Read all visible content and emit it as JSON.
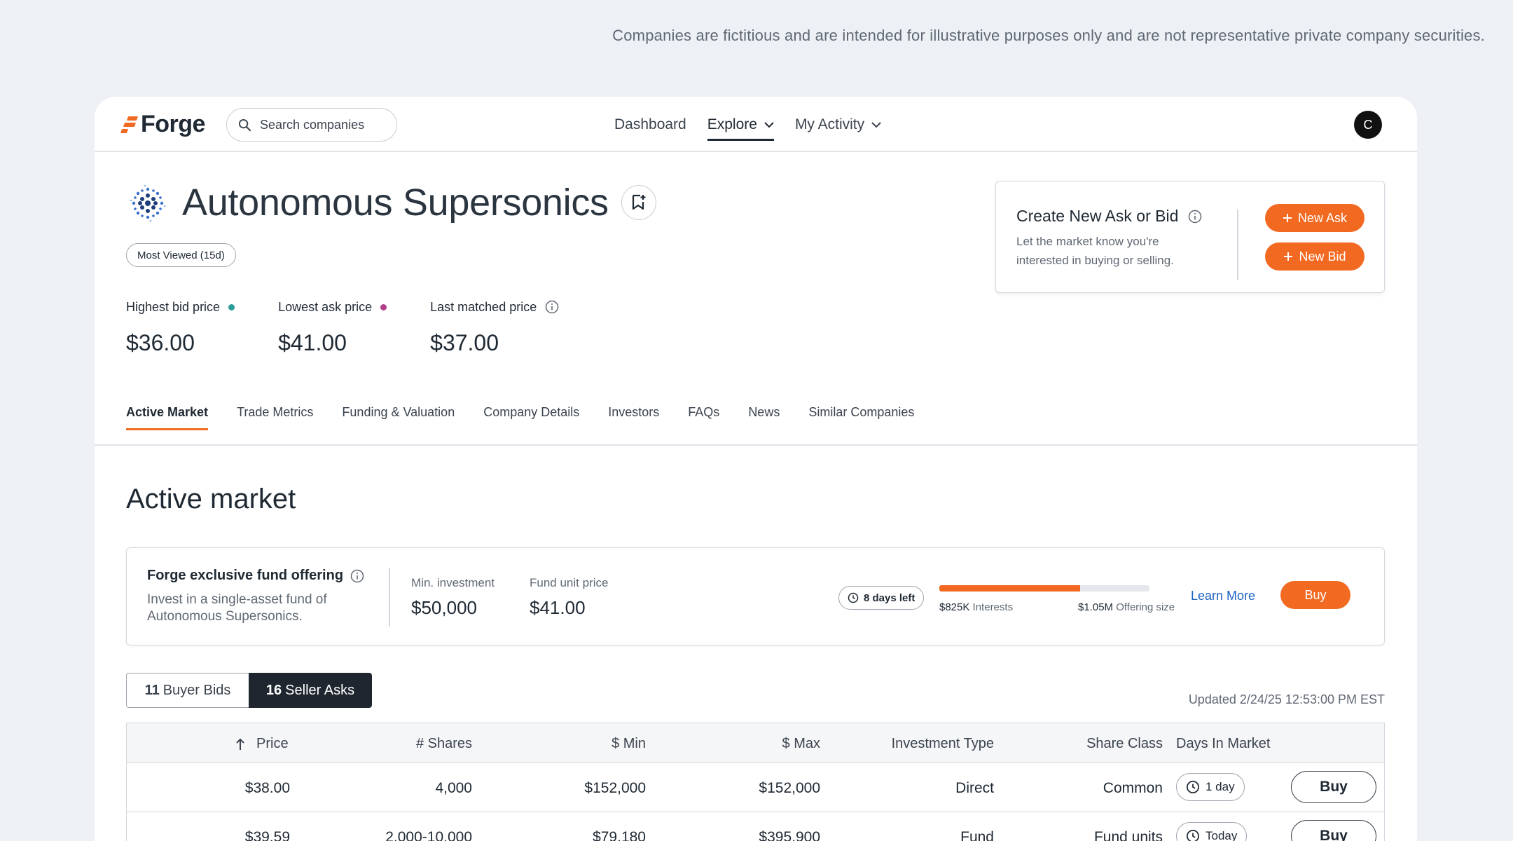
{
  "disclaimer": "Companies are fictitious and are intended for illustrative purposes only and are not representative private company securities.",
  "nav": {
    "brand": "Forge",
    "search_placeholder": "Search companies",
    "links": [
      "Dashboard",
      "Explore",
      "My Activity"
    ],
    "avatar_initial": "C"
  },
  "company": {
    "name": "Autonomous Supersonics",
    "badge": "Most Viewed (15d)"
  },
  "prices": [
    {
      "label": "Highest bid price",
      "value": "$36.00",
      "dot_color": "#2a9d9b"
    },
    {
      "label": "Lowest ask price",
      "value": "$41.00",
      "dot_color": "#b03f8b"
    },
    {
      "label": "Last matched price",
      "value": "$37.00"
    }
  ],
  "create": {
    "title": "Create New Ask or Bid",
    "desc": "Let the market know you're interested in buying or selling.",
    "new_ask": "New Ask",
    "new_bid": "New Bid"
  },
  "tabs": [
    "Active Market",
    "Trade Metrics",
    "Funding & Valuation",
    "Company Details",
    "Investors",
    "FAQs",
    "News",
    "Similar Companies"
  ],
  "section_title": "Active market",
  "fund": {
    "title": "Forge exclusive fund offering",
    "desc": "Invest in a single-asset fund of Autonomous Supersonics.",
    "min_label": "Min. investment",
    "min_value": "$50,000",
    "unit_label": "Fund unit price",
    "unit_value": "$41.00",
    "days_left": "8 days left",
    "progress": 0.67,
    "interests_value": "$825K",
    "interests_label": "Interests",
    "offering_value": "$1.05M",
    "offering_label": "Offering size",
    "learn_more": "Learn More",
    "buy": "Buy"
  },
  "toggle": {
    "bids_count": "11",
    "bids_label": "Buyer Bids",
    "asks_count": "16",
    "asks_label": "Seller Asks"
  },
  "updated": "Updated 2/24/25 12:53:00 PM EST",
  "table": {
    "headers": [
      "Price",
      "# Shares",
      "$ Min",
      "$ Max",
      "Investment Type",
      "Share Class",
      "Days In Market"
    ],
    "rows": [
      {
        "price": "$38.00",
        "shares": "4,000",
        "min": "$152,000",
        "max": "$152,000",
        "type": "Direct",
        "class": "Common",
        "days": "1 day",
        "action": "Buy"
      },
      {
        "price": "$39.59",
        "shares": "2,000-10,000",
        "min": "$79,180",
        "max": "$395,900",
        "type": "Fund",
        "class": "Fund units",
        "days": "Today",
        "action": "Buy"
      }
    ]
  },
  "colors": {
    "accent": "#f26a22",
    "link": "#1e63c4",
    "dark": "#1f2630"
  }
}
